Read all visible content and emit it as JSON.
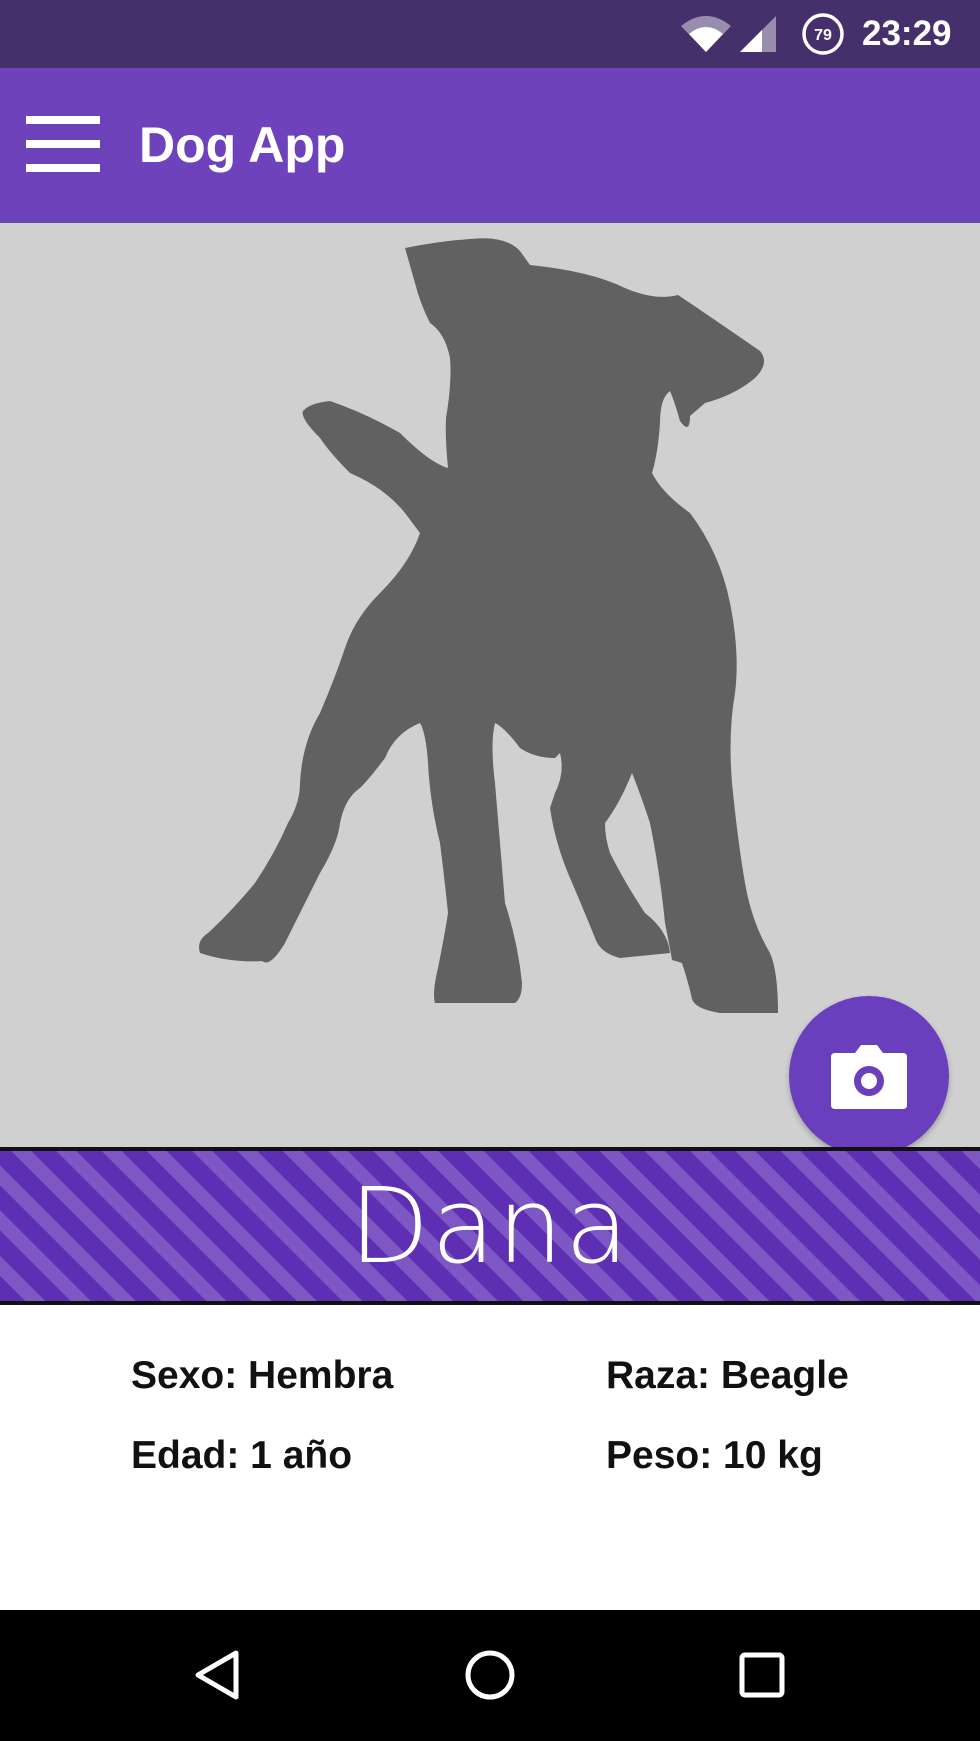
{
  "status_bar": {
    "time": "23:29",
    "battery_level": "79",
    "icons": [
      "wifi-icon",
      "cell-signal-icon",
      "battery-icon"
    ]
  },
  "app_bar": {
    "title": "Dog App",
    "menu_icon": "hamburger-menu-icon"
  },
  "photo": {
    "placeholder_icon": "dog-silhouette",
    "actions": [
      {
        "name": "take-photo",
        "icon": "camera-icon",
        "color": "#6a3fbd"
      },
      {
        "name": "choose-image",
        "icon": "image-file-icon",
        "color": "#f58a07"
      }
    ]
  },
  "dog": {
    "name": "Dana",
    "sex": "Sexo: Hembra",
    "breed": "Raza: Beagle",
    "age": "Edad: 1 año",
    "weight": "Peso: 10 kg"
  },
  "nav_bar": {
    "buttons": [
      "back-icon",
      "home-icon",
      "recents-icon"
    ]
  },
  "colors": {
    "status_bar": "#46306c",
    "app_bar": "#6d42bb",
    "accent_purple": "#6a3fbd",
    "accent_orange": "#f58a07",
    "photo_background": "#d0d0d0",
    "silhouette": "#616161"
  }
}
